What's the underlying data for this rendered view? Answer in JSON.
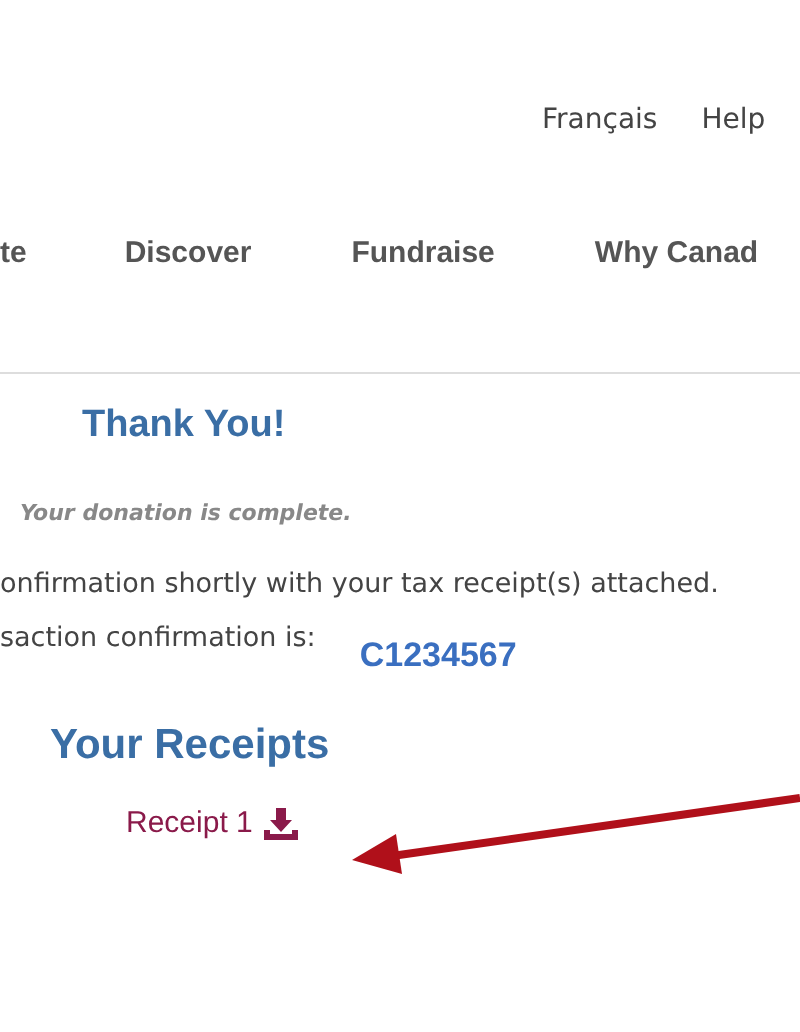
{
  "utility_links": [
    "Français",
    "Help"
  ],
  "nav_items": [
    "te",
    "Discover",
    "Fundraise",
    "Why Canad"
  ],
  "heading": "Thank You!",
  "status": "Your donation is complete.",
  "message": "onfirmation shortly with your tax receipt(s) attached.",
  "confirmation": {
    "label": "saction confirmation is:",
    "number": "C1234567"
  },
  "receipts": {
    "title": "Your Receipts",
    "items": [
      "Receipt 1"
    ]
  }
}
